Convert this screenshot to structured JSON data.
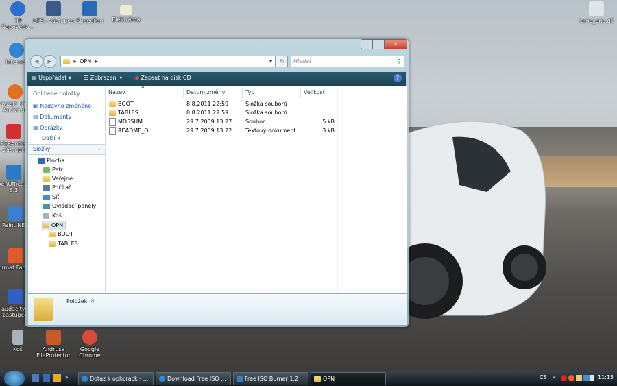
{
  "desktop": {
    "icons": [
      {
        "label": "HP Napověda...",
        "color": "#2a6fd0"
      },
      {
        "label": "UFS - zástupce",
        "color": "#3a5a8a"
      },
      {
        "label": "SpeedFan",
        "color": "#2a6ab8"
      },
      {
        "label": "Elektrárna",
        "color": "#e8d070"
      },
      {
        "label": "lame_enc.dll",
        "color": "#dfe6ea"
      },
      {
        "label": "Internet",
        "color": "#2f86d8"
      },
      {
        "label": "avast! Free Antivirus",
        "color": "#e07020"
      },
      {
        "label": "SUPERAntiSpyware - zástupce",
        "color": "#d03030"
      },
      {
        "label": "OpenOffice.org 3.3",
        "color": "#2a7ac8"
      },
      {
        "label": "Paint.NET",
        "color": "#3a80d0"
      },
      {
        "label": "Format Factory",
        "color": "#e05a2a"
      },
      {
        "label": "audacity - zástupce",
        "color": "#3060c0"
      },
      {
        "label": "Koš",
        "color": "#a8b4bc"
      },
      {
        "label": "Andrusa FileProtector",
        "color": "#c85a2a"
      },
      {
        "label": "Google Chrome",
        "color": "#d94a3a"
      }
    ]
  },
  "window": {
    "breadcrumb": "OPN",
    "search_placeholder": "Hledat",
    "toolbar": {
      "organize": "Uspořádat",
      "views": "Zobrazení",
      "burn": "Zapsat na disk CD"
    },
    "nav": {
      "favorites_title": "Oblíbené položky",
      "favorites": [
        "Nedávno změněné",
        "Dokumenty",
        "Obrázky"
      ],
      "more": "Další",
      "folders_title": "Složky",
      "tree": [
        "Plocha",
        "Petr",
        "Veřejné",
        "Počítač",
        "Síť",
        "Ovládací panely",
        "Koš",
        "OPN",
        "BOOT",
        "TABLES"
      ]
    },
    "columns": [
      "Název",
      "Datum změny",
      "Typ",
      "Velikost"
    ],
    "files": [
      {
        "name": "BOOT",
        "date": "8.8.2011 22:59",
        "type": "Složka souborů",
        "size": "",
        "kind": "folder"
      },
      {
        "name": "TABLES",
        "date": "8.8.2011 22:59",
        "type": "Složka souborů",
        "size": "",
        "kind": "folder"
      },
      {
        "name": "MD5SUM",
        "date": "29.7.2009 13:27",
        "type": "Soubor",
        "size": "5 kB",
        "kind": "file"
      },
      {
        "name": "README_O",
        "date": "29.7.2009 13:22",
        "type": "Textový dokument",
        "size": "3 kB",
        "kind": "file"
      }
    ],
    "details": "Položek: 4"
  },
  "taskbar": {
    "tasks": [
      "Dotaz k ophcrack - ...",
      "Download Free ISO ...",
      "Free ISO Burner 1.2",
      "OPN"
    ],
    "language": "CS",
    "clock": "11:15"
  }
}
